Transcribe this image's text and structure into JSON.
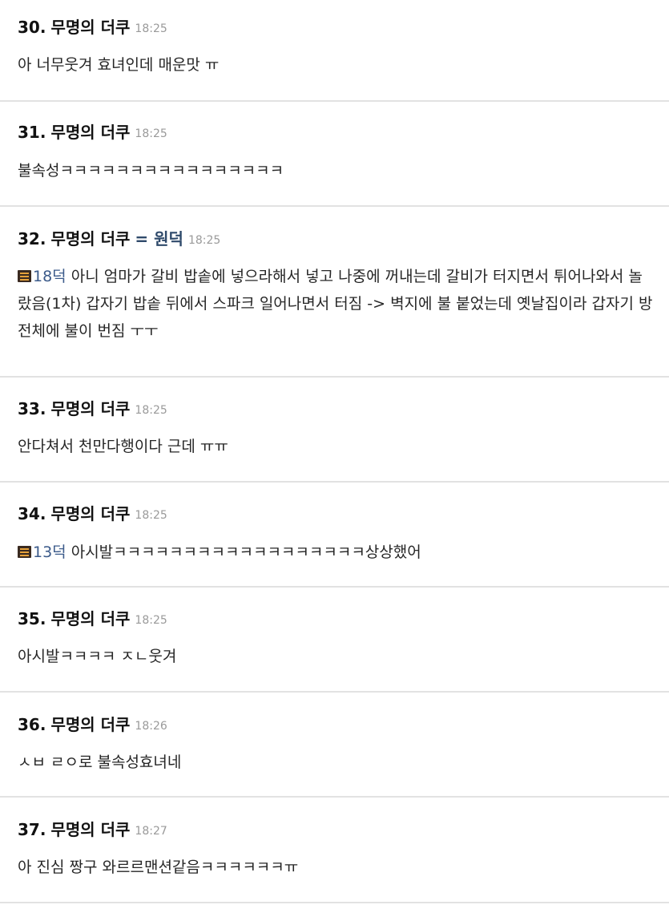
{
  "comments": [
    {
      "num": "30.",
      "author": "무명의 더쿠",
      "time": "18:25",
      "text": "아 너무웃겨 효녀인데 매운맛 ㅠ"
    },
    {
      "num": "31.",
      "author": "무명의 더쿠",
      "time": "18:25",
      "text": "불속성ㅋㅋㅋㅋㅋㅋㅋㅋㅋㅋㅋㅋㅋㅋㅋㅋ"
    },
    {
      "num": "32.",
      "author": "무명의 더쿠",
      "op_badge": "= 원덕",
      "time": "18:25",
      "reply_ref": "18덕",
      "text": "아니 엄마가 갈비 밥솥에 넣으라해서 넣고 나중에 꺼내는데 갈비가 터지면서 튀어나와서 놀랐음(1차) 갑자기 밥솥 뒤에서 스파크 일어나면서 터짐 -> 벽지에 불 붙었는데 옛날집이라 갑자기 방 전체에 불이 번짐 ㅜㅜ"
    },
    {
      "num": "33.",
      "author": "무명의 더쿠",
      "time": "18:25",
      "text": "안다쳐서 천만다행이다 근데 ㅠㅠ"
    },
    {
      "num": "34.",
      "author": "무명의 더쿠",
      "time": "18:25",
      "reply_ref": "13덕",
      "text": "아시발ㅋㅋㅋㅋㅋㅋㅋㅋㅋㅋㅋㅋㅋㅋㅋㅋㅋㅋ상상했어"
    },
    {
      "num": "35.",
      "author": "무명의 더쿠",
      "time": "18:25",
      "text": "아시발ㅋㅋㅋㅋ ㅈㄴ웃겨"
    },
    {
      "num": "36.",
      "author": "무명의 더쿠",
      "time": "18:26",
      "text": "ㅅㅂ ㄹㅇ로 불속성효녀네"
    },
    {
      "num": "37.",
      "author": "무명의 더쿠",
      "time": "18:27",
      "text": "아 진심 짱구 와르르맨션같음ㅋㅋㅋㅋㅋㅋㅠ"
    }
  ],
  "colors": {
    "op_badge": "#2f4a6b",
    "reply_ref": "#3b5a8a",
    "time": "#9a9a9a",
    "divider": "#e2e2e2"
  }
}
